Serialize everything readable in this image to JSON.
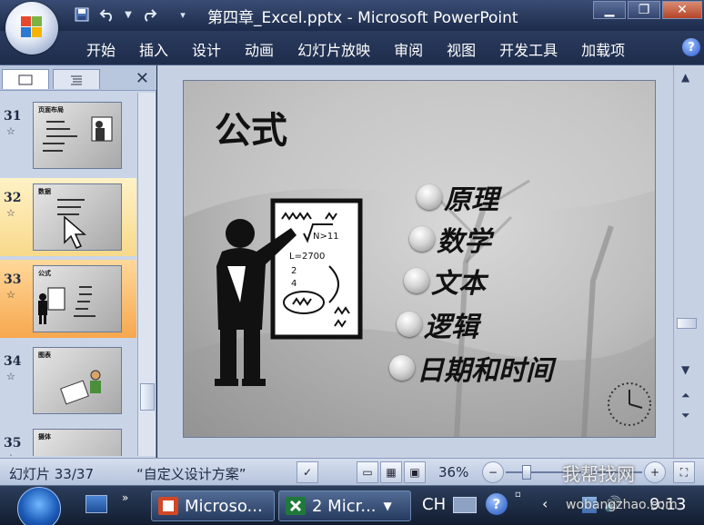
{
  "window": {
    "title": "第四章_Excel.pptx - Microsoft PowerPoint",
    "minimize": "▁",
    "restore": "❐",
    "close": "✕"
  },
  "ribbon": {
    "tabs": [
      "开始",
      "插入",
      "设计",
      "动画",
      "幻灯片放映",
      "审阅",
      "视图",
      "开发工具",
      "加载项"
    ],
    "help": "?"
  },
  "pane": {
    "close": "✕",
    "thumbnails": [
      {
        "num": "31",
        "title": "页面布局"
      },
      {
        "num": "32",
        "title": "数据"
      },
      {
        "num": "33",
        "title": "公式"
      },
      {
        "num": "34",
        "title": "图表"
      },
      {
        "num": "35",
        "title": "摄体"
      }
    ],
    "star": "☆"
  },
  "slide": {
    "title": "公式",
    "bullets": [
      "原理",
      "数学",
      "文本",
      "逻辑",
      "日期和时间"
    ]
  },
  "status": {
    "slide_counter": "幻灯片 33/37",
    "theme": "“自定义设计方案”",
    "zoom": "36%"
  },
  "taskbar": {
    "ppt_task": "Microso...",
    "excel_task": "2 Micr...",
    "lang": "CH",
    "time": "9:13"
  },
  "watermark": {
    "line1": "我帮找网",
    "line2": "wobangzhao.com"
  }
}
